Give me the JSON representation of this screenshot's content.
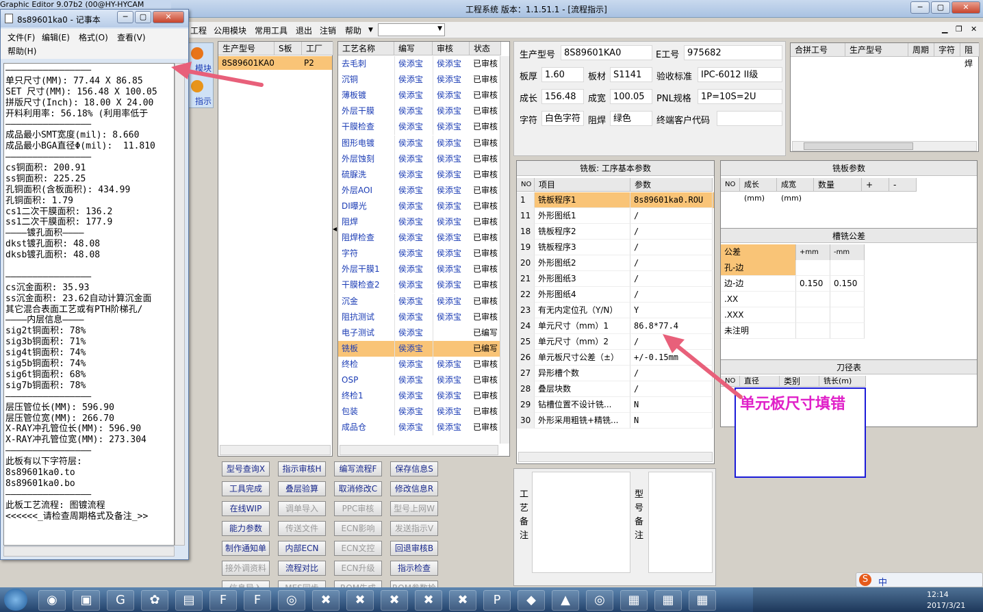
{
  "main_window": {
    "title": "工程系统   版本：1.1.51.1 - [流程指示]",
    "menus": [
      "工程",
      "公用模块",
      "常用工具",
      "退出",
      "注销",
      "帮助"
    ],
    "left_tabs": [
      "模块",
      "指示"
    ]
  },
  "product_list": {
    "headers": [
      "生产型号",
      "S板",
      "工厂"
    ],
    "rows": [
      [
        "8S89601KA0",
        "",
        "P2"
      ]
    ]
  },
  "process_list": {
    "headers": [
      "工艺名称",
      "编写",
      "审核",
      "状态"
    ],
    "rows": [
      [
        "去毛刺",
        "侯添宝",
        "侯添宝",
        "已审核"
      ],
      [
        "沉铜",
        "侯添宝",
        "侯添宝",
        "已审核"
      ],
      [
        "薄板镀",
        "侯添宝",
        "侯添宝",
        "已审核"
      ],
      [
        "外层干膜",
        "侯添宝",
        "侯添宝",
        "已审核"
      ],
      [
        "干膜检查",
        "侯添宝",
        "侯添宝",
        "已审核"
      ],
      [
        "图形电镀",
        "侯添宝",
        "侯添宝",
        "已审核"
      ],
      [
        "外层蚀刻",
        "侯添宝",
        "侯添宝",
        "已审核"
      ],
      [
        "硫脲洗",
        "侯添宝",
        "侯添宝",
        "已审核"
      ],
      [
        "外层AOI",
        "侯添宝",
        "侯添宝",
        "已审核"
      ],
      [
        "DI曝光",
        "侯添宝",
        "侯添宝",
        "已审核"
      ],
      [
        "阻焊",
        "侯添宝",
        "侯添宝",
        "已审核"
      ],
      [
        "阻焊检查",
        "侯添宝",
        "侯添宝",
        "已审核"
      ],
      [
        "字符",
        "侯添宝",
        "侯添宝",
        "已审核"
      ],
      [
        "外层干膜1",
        "侯添宝",
        "侯添宝",
        "已审核"
      ],
      [
        "干膜检查2",
        "侯添宝",
        "侯添宝",
        "已审核"
      ],
      [
        "沉金",
        "侯添宝",
        "侯添宝",
        "已审核"
      ],
      [
        "阻抗测试",
        "侯添宝",
        "侯添宝",
        "已审核"
      ],
      [
        "电子测试",
        "侯添宝",
        "",
        "已编写"
      ],
      [
        "铣板",
        "侯添宝",
        "",
        "已编写"
      ],
      [
        "终检",
        "侯添宝",
        "侯添宝",
        "已审核"
      ],
      [
        "OSP",
        "侯添宝",
        "侯添宝",
        "已审核"
      ],
      [
        "终检1",
        "侯添宝",
        "侯添宝",
        "已审核"
      ],
      [
        "包装",
        "侯添宝",
        "侯添宝",
        "已审核"
      ],
      [
        "成品仓",
        "侯添宝",
        "侯添宝",
        "已审核"
      ]
    ],
    "selected_index": 18
  },
  "buttons": [
    [
      "型号查询X",
      "指示审核H",
      "编写流程F",
      "保存信息S"
    ],
    [
      "工具完成",
      "叠层验算",
      "取消修改C",
      "修改信息R"
    ],
    [
      "在线WIP",
      "调单导入",
      "PPC审核",
      "型号上网W"
    ],
    [
      "能力参数",
      "传送文件",
      "ECN影响",
      "发送指示V"
    ],
    [
      "制作通知单",
      "内部ECN",
      "ECN文控",
      "回退审核B"
    ],
    [
      "接外调资料",
      "流程对比",
      "ECN升级",
      "指示检查"
    ],
    [
      "信息导入",
      "MES同步",
      "ROM生成",
      "ROM参数检查"
    ]
  ],
  "disabled_buttons": [
    "调单导入",
    "PPC审核",
    "型号上网W",
    "传送文件",
    "ECN影响",
    "发送指示V",
    "ECN文控",
    "接外调资料",
    "ECN升级",
    "MES同步",
    "ROM生成",
    "ROM参数检查",
    "信息导入"
  ],
  "info": {
    "model_label": "生产型号",
    "model": "8S89601KA0",
    "eng_label": "E工号",
    "eng": "975682",
    "thick_label": "板厚",
    "thick": "1.60",
    "material_label": "板材",
    "material": "S1141",
    "std_label": "验收标准",
    "std": "IPC-6012 II级",
    "len_label": "成长",
    "len": "156.48",
    "wid_label": "成宽",
    "wid": "100.05",
    "pnl_label": "PNL规格",
    "pnl": "1P=10S=2U",
    "char_label": "字符",
    "char": "白色字符",
    "mask_label": "阻焊",
    "mask": "绿色",
    "cust_label": "终端客户代码",
    "cust": ""
  },
  "merge_table": {
    "headers": [
      "合拼工号",
      "生产型号",
      "周期",
      "字符",
      "阻焊"
    ]
  },
  "milling_basic": {
    "title": "铣板: 工序基本参数",
    "headers": [
      "NO",
      "项目",
      "参数"
    ],
    "rows": [
      [
        "1",
        "铣板程序1",
        "8s89601ka0.ROU"
      ],
      [
        "11",
        "外形图纸1",
        "/"
      ],
      [
        "18",
        "铣板程序2",
        "/"
      ],
      [
        "19",
        "铣板程序3",
        "/"
      ],
      [
        "20",
        "外形图纸2",
        "/"
      ],
      [
        "21",
        "外形图纸3",
        "/"
      ],
      [
        "22",
        "外形图纸4",
        "/"
      ],
      [
        "23",
        "有无内定位孔（Y/N）",
        "Y"
      ],
      [
        "24",
        "单元尺寸（mm）1",
        "86.8*77.4"
      ],
      [
        "25",
        "单元尺寸（mm）2",
        "/"
      ],
      [
        "26",
        "单元板尺寸公差（±）",
        "+/-0.15mm"
      ],
      [
        "27",
        "异形槽个数",
        "/"
      ],
      [
        "28",
        "叠层块数",
        "/"
      ],
      [
        "29",
        "钻槽位置不设计铣...",
        "N"
      ],
      [
        "30",
        "外形采用粗铣+精铣...",
        "N"
      ]
    ]
  },
  "milling_params": {
    "title": "铣板参数",
    "headers": [
      "NO",
      "成长(mm)",
      "成宽(mm)",
      "数量",
      "+",
      "-"
    ]
  },
  "slot_tol": {
    "title": "槽铣公差",
    "headers": [
      "公差",
      "+mm",
      "-mm"
    ],
    "rows": [
      [
        "孔-边",
        "",
        ""
      ],
      [
        "边-边",
        "0.150",
        "0.150"
      ],
      [
        ".XX",
        "",
        ""
      ],
      [
        ".XXX",
        "",
        ""
      ],
      [
        "未注明",
        "",
        ""
      ]
    ]
  },
  "tool_table": {
    "title": "刀径表",
    "headers": [
      "NO",
      "直径(mm)",
      "类别",
      "铣长(m)"
    ]
  },
  "remarks": {
    "process_label": "工艺备注",
    "model_label": "型号备注"
  },
  "annotation": "单元板尺寸填错",
  "notepad": {
    "title": "8s89601ka0 - 记事本",
    "behind_title": "Graphic Editor 9.07b2 (00@HY-HYCAM",
    "menus": [
      "文件(F)",
      "编辑(E)",
      "格式(O)",
      "查看(V)",
      "帮助(H)"
    ],
    "lines": [
      "————————————————",
      "单只尺寸(MM): 77.44 X 86.85",
      "SET 尺寸(MM): 156.48 X 100.05",
      "拼版尺寸(Inch): 18.00 X 24.00",
      "开料利用率: 56.18% (利用率低于",
      "————————————————",
      "成品最小SMT宽度(mil): 8.660",
      "成品最小BGA直径Φ(mil):  11.810",
      "————————————————",
      "cs铜面积: 200.91",
      "ss铜面积: 225.25",
      "孔铜面积(含板面积): 434.99",
      "孔铜面积: 1.79",
      "cs1二次干膜面积: 136.2",
      "ss1二次干膜面积: 177.9",
      "————镀孔面积————",
      "dkst镀孔面积: 48.08",
      "dksb镀孔面积: 48.08",
      "",
      "————————————————",
      "cs沉金面积: 35.93",
      "ss沉金面积: 23.62自动计算沉金面",
      "其它混合表面工艺或有PTH阶梯孔/",
      "————内层信息————",
      "sig2t铜面积: 78%",
      "sig3b铜面积: 71%",
      "sig4t铜面积: 74%",
      "sig5b铜面积: 74%",
      "sig6t铜面积: 68%",
      "sig7b铜面积: 78%",
      "————————————————",
      "层压管位长(MM): 596.90",
      "层压管位宽(MM): 266.70",
      "X-RAY冲孔管位长(MM): 596.90",
      "X-RAY冲孔管位宽(MM): 273.304",
      "————————————————",
      "此板有以下字符层:",
      "8s89601ka0.to",
      "8s89601ka0.bo",
      "————————————————",
      "此板工艺流程: 图镀流程",
      "<<<<<<_请检查周期格式及备注_>>"
    ]
  },
  "tray": {
    "time": "12:14",
    "date": "2017/3/21",
    "ime": "中"
  }
}
